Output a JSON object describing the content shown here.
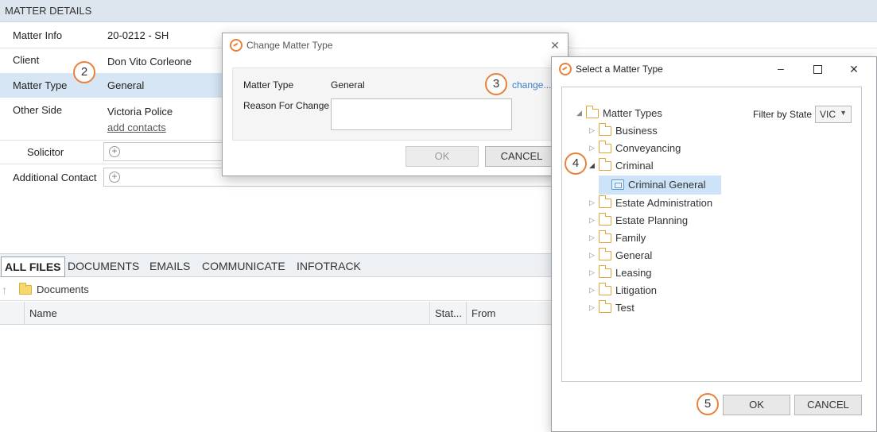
{
  "matter_details": {
    "header": "MATTER DETAILS",
    "rows": [
      {
        "label": "Matter Info",
        "value": "20-0212 - SH"
      },
      {
        "label": "Client",
        "value": "Don Vito Corleone"
      },
      {
        "label": "Matter Type",
        "value": "General"
      },
      {
        "label": "Other Side",
        "value": "Victoria Police",
        "link": "add contacts"
      }
    ],
    "solicitor_label": "Solicitor",
    "additional_contact_label": "Additional Contact"
  },
  "files": {
    "tabs": [
      "ALL FILES",
      "DOCUMENTS",
      "EMAILS",
      "COMMUNICATE",
      "INFOTRACK"
    ],
    "path": "Documents",
    "columns": [
      "Name",
      "Stat...",
      "From"
    ]
  },
  "change_dialog": {
    "title": "Change Matter Type",
    "matter_type_label": "Matter Type",
    "matter_type_value": "General",
    "change_link": "change...",
    "reason_label": "Reason For Change",
    "reason_value": "",
    "ok_label": "OK",
    "cancel_label": "CANCEL"
  },
  "select_dialog": {
    "title": "Select a Matter Type",
    "filter_label": "Filter by State",
    "filter_value": "VIC",
    "root": "Matter Types",
    "items": [
      "Business",
      "Conveyancing",
      "Criminal",
      "Estate Administration",
      "Estate Planning",
      "Family",
      "General",
      "Leasing",
      "Litigation",
      "Test"
    ],
    "selected_child": "Criminal General",
    "ok_label": "OK",
    "cancel_label": "CANCEL"
  },
  "callouts": [
    "2",
    "3",
    "4",
    "5"
  ],
  "colors": {
    "accent": "#e8823a",
    "selection": "#cde3f7",
    "link": "#3a7bc8"
  }
}
